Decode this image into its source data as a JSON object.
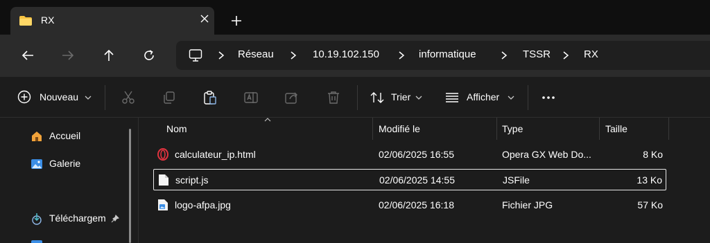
{
  "tab": {
    "title": "RX"
  },
  "breadcrumb": [
    "Réseau",
    "10.19.102.150",
    "informatique",
    "TSSR",
    "RX"
  ],
  "toolbar": {
    "new_label": "Nouveau",
    "sort_label": "Trier",
    "view_label": "Afficher"
  },
  "sidebar": {
    "items": [
      {
        "label": "Accueil"
      },
      {
        "label": "Galerie"
      },
      {
        "label": "Téléchargem"
      }
    ]
  },
  "columns": {
    "name": "Nom",
    "modified": "Modifié le",
    "type": "Type",
    "size": "Taille"
  },
  "files": [
    {
      "name": "calculateur_ip.html",
      "modified": "02/06/2025 16:55",
      "type": "Opera GX Web Do...",
      "size": "8 Ko"
    },
    {
      "name": "script.js",
      "modified": "02/06/2025 14:55",
      "type": "JSFile",
      "size": "13 Ko"
    },
    {
      "name": "logo-afpa.jpg",
      "modified": "02/06/2025 16:18",
      "type": "Fichier JPG",
      "size": "57 Ko"
    }
  ]
}
